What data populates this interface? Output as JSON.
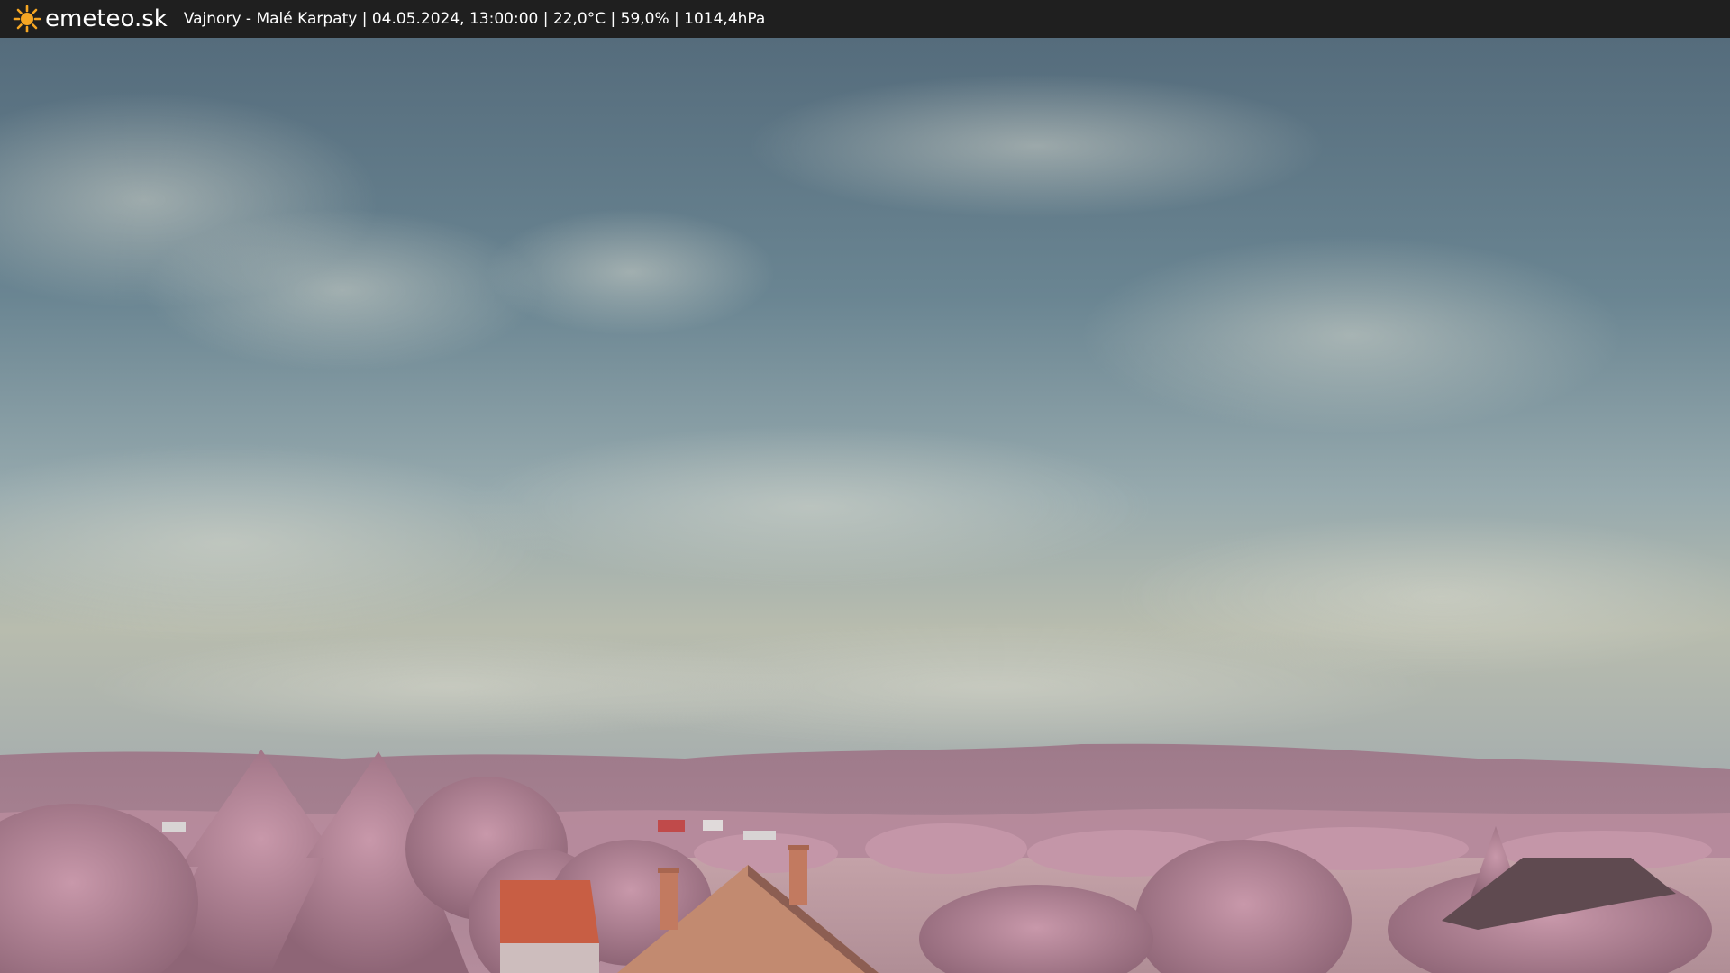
{
  "header": {
    "brand": "emeteo.sk",
    "caption": "Vajnory - Malé Karpaty | 04.05.2024, 13:00:00 | 22,0°C | 59,0% | 1014,4hPa",
    "logo_icon": "sun-icon",
    "bar_color": "#1f1f1f",
    "sun_color": "#f5a623"
  },
  "scene": {
    "sky_top": "#566d7d",
    "sky_mid": "#7d96a0",
    "sky_horizon": "#b7bdb0",
    "hills": "#a27a8c",
    "foliage": "#c08ea2",
    "roof": "#b5583e",
    "field": "#b89aa0"
  }
}
